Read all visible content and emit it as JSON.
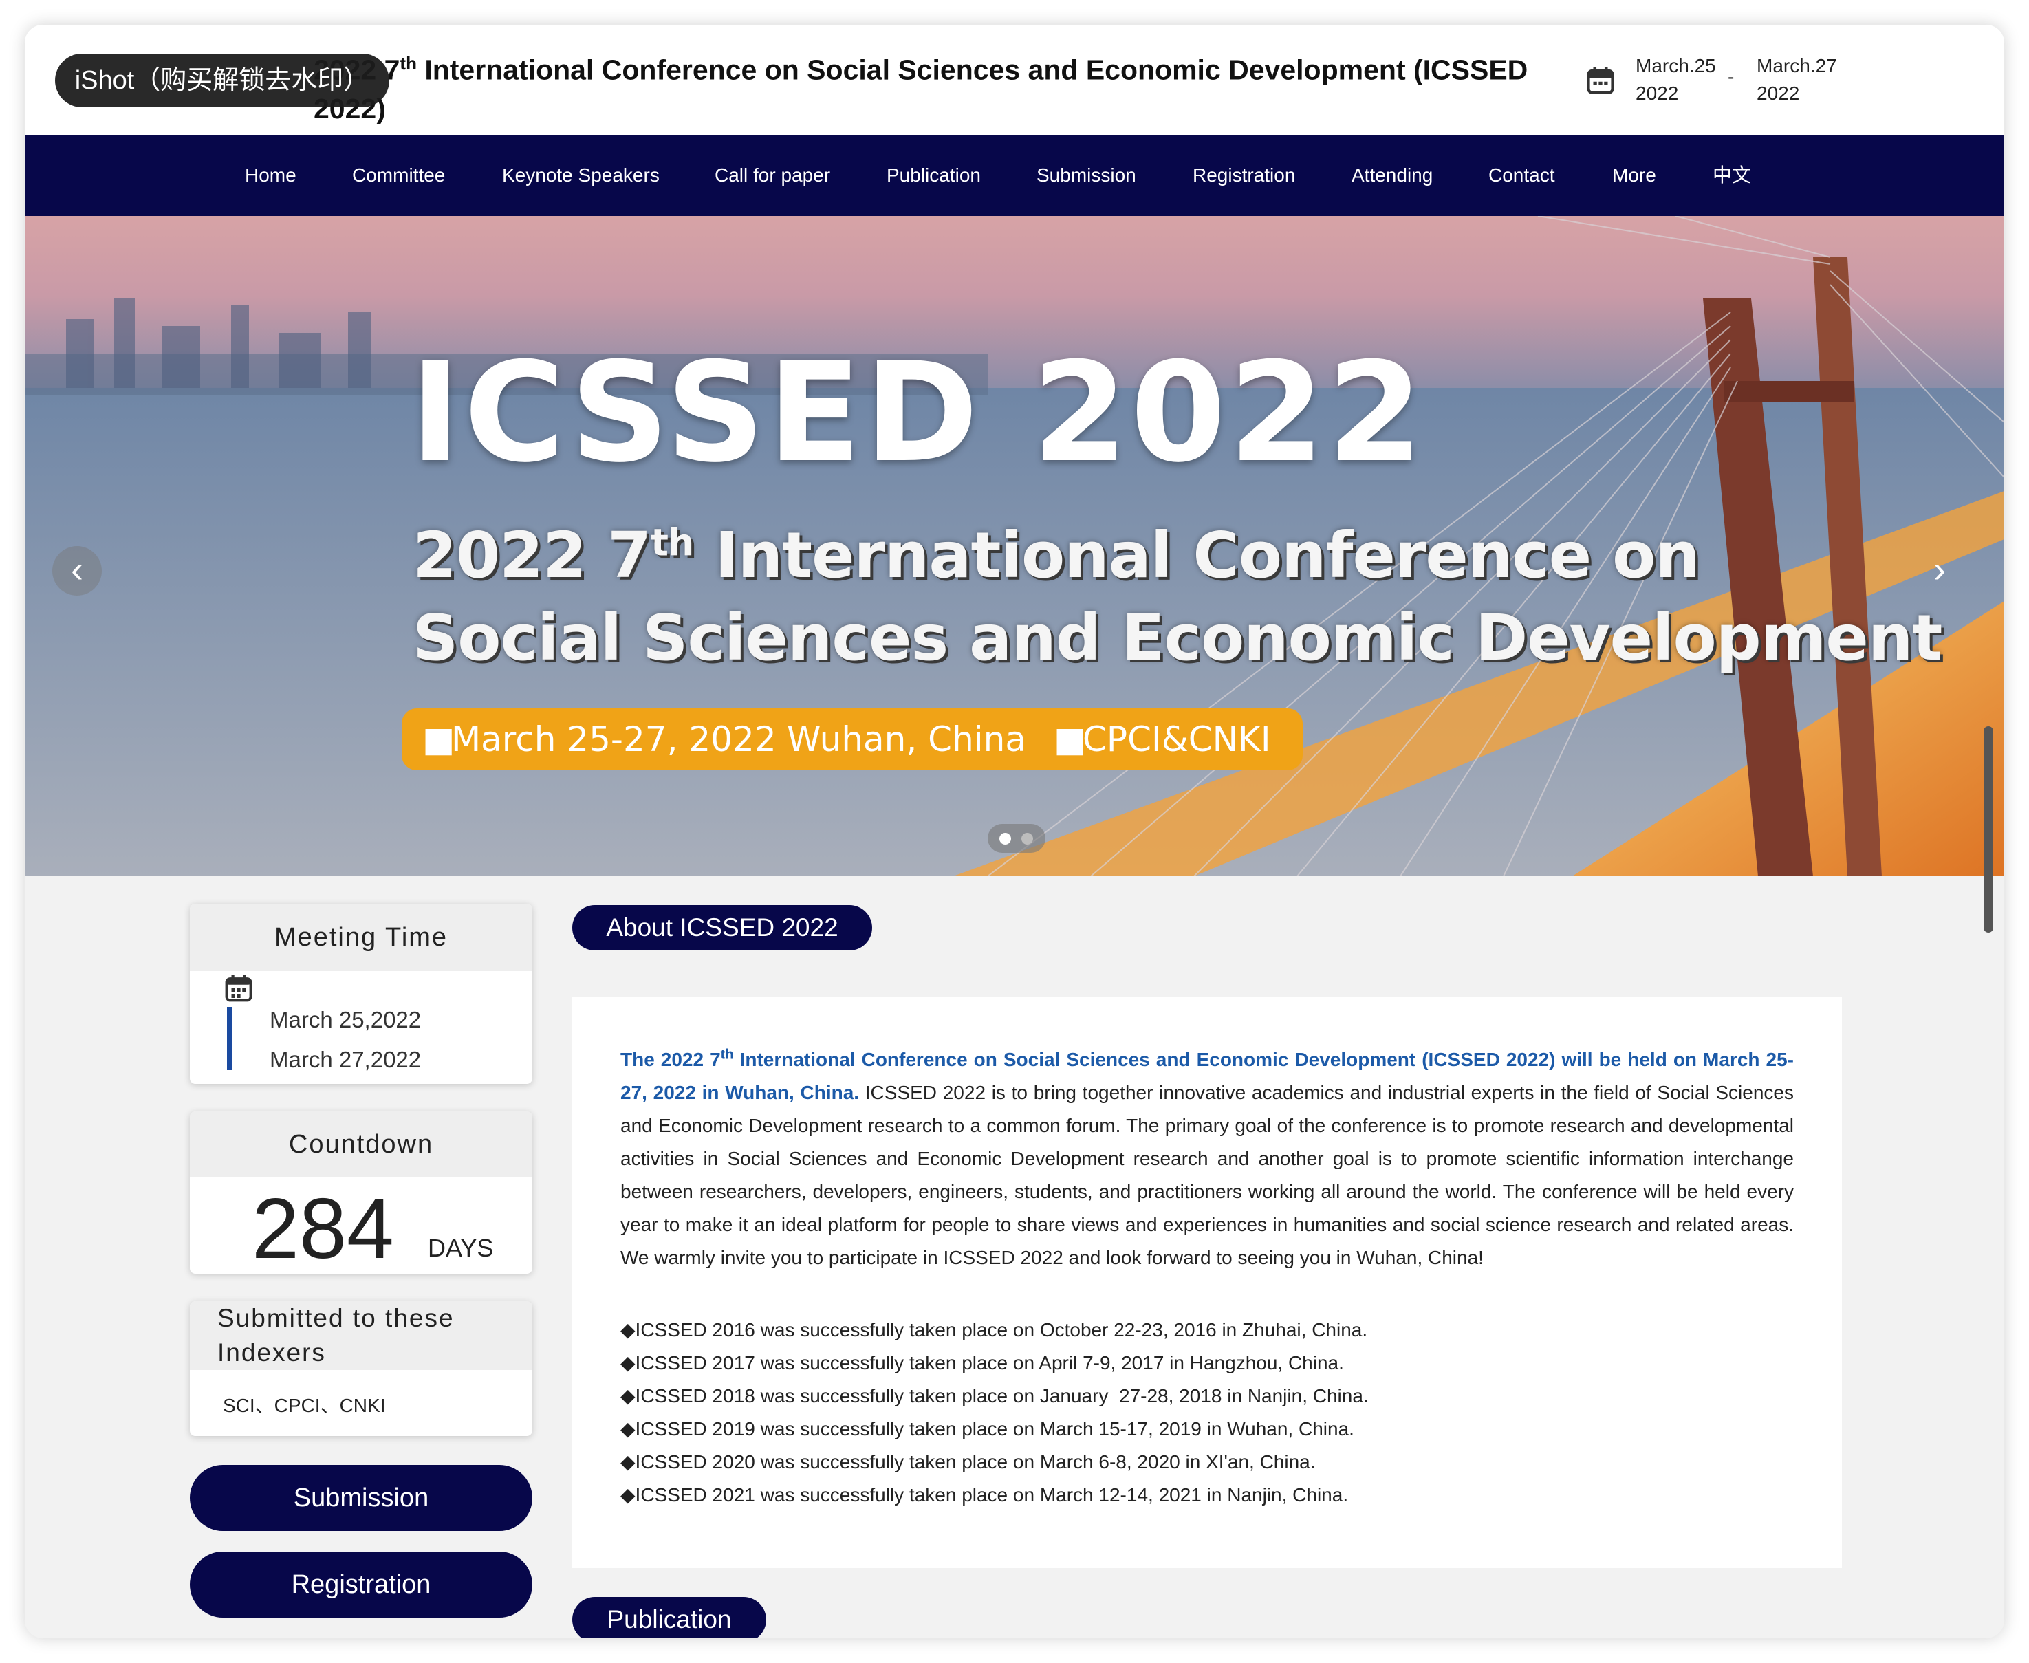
{
  "watermark": "iShot（购买解锁去水印）",
  "header": {
    "title_prefix": "2022 7",
    "title_sup": "th",
    "title_rest": " International Conference on Social Sciences and Economic Development (ICSSED 2022)",
    "start_date": "March.25",
    "start_year": "2022",
    "dash": "-",
    "end_date": "March.27",
    "end_year": "2022"
  },
  "nav": [
    "Home",
    "Committee",
    "Keynote Speakers",
    "Call for paper",
    "Publication",
    "Submission",
    "Registration",
    "Attending",
    "Contact",
    "More",
    "中文"
  ],
  "banner": {
    "big": "ICSSED 2022",
    "line1_prefix": "2022 7",
    "line1_sup": "th",
    "line1_rest": " International Conference on",
    "line2": "Social Sciences and Economic Development",
    "pill_date": "March 25-27, 2022",
    "pill_place": "Wuhan, China",
    "pill_index": "CPCI&CNKI",
    "prev": "‹",
    "next": "›"
  },
  "sidebar": {
    "meeting_title": "Meeting Time",
    "meeting_start": "March 25,2022",
    "meeting_end": "March 27,2022",
    "countdown_title": "Countdown",
    "countdown_value": "284",
    "countdown_unit": "DAYS",
    "indexers_title": "Submitted to these Indexers",
    "indexers_list": "SCI、CPCI、CNKI",
    "submission_btn": "Submission",
    "registration_btn": "Registration"
  },
  "about": {
    "title": "About ICSSED 2022",
    "hl_prefix": "The 2022 7",
    "hl_sup": "th",
    "hl_rest": " International Conference on Social Sciences and Economic Development (ICSSED 2022) will be held on March 25-27, 2022 in Wuhan, China.",
    "body": " ICSSED 2022 is to bring together innovative academics and industrial experts in the field of Social Sciences and Economic Development research to a common forum. The primary goal of the conference is to promote research and developmental activities in Social Sciences and Economic Development research and another goal is to promote scientific information interchange between researchers, developers, engineers, students, and practitioners working all around the world. The conference will be held every year to make it an ideal platform for people to share views and experiences in humanities and social science research and related areas. We warmly invite you to participate in ICSSED 2022 and look forward to seeing you in Wuhan, China!",
    "history": [
      "◆ICSSED 2016 was successfully taken place on October 22-23, 2016 in Zhuhai, China.",
      "◆ICSSED 2017 was successfully taken place on April 7-9, 2017 in Hangzhou, China.",
      "◆ICSSED 2018 was successfully taken place on January  27-28, 2018 in Nanjin, China.",
      "◆ICSSED 2019 was successfully taken place on March 15-17, 2019 in Wuhan, China.",
      "◆ICSSED 2020 was successfully taken place on March 6-8, 2020 in XI'an, China.",
      "◆ICSSED 2021 was successfully taken place on March 12-14, 2021 in Nanjin, China."
    ]
  },
  "publication_title": "Publication",
  "colors": {
    "navy": "#07074a",
    "accent_blue": "#1c5aa8",
    "banner_pill": "#f0a317"
  }
}
